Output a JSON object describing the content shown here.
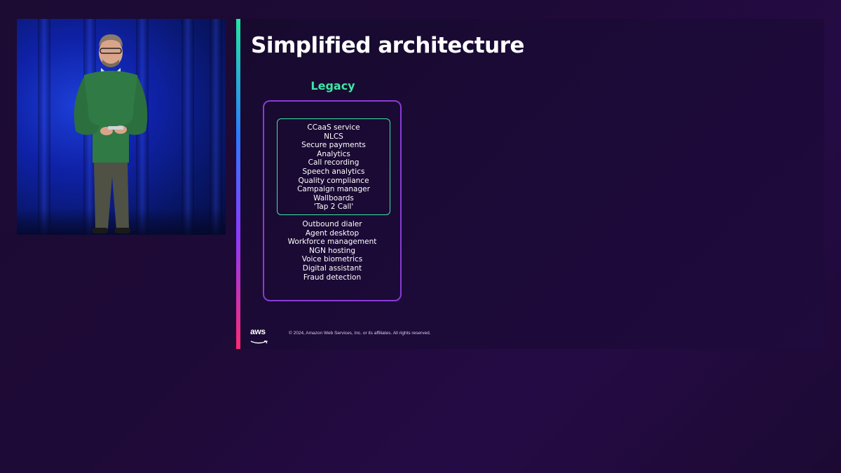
{
  "slide": {
    "title": "Simplified architecture",
    "legacy": {
      "heading": "Legacy",
      "inner_items": [
        "CCaaS service",
        "NLCS",
        "Secure payments",
        "Analytics",
        "Call recording",
        "Speech analytics",
        "Quality compliance",
        "Campaign manager",
        "Wallboards",
        "'Tap 2 Call'"
      ],
      "outer_items": [
        "Outbound dialer",
        "Agent desktop",
        "Workforce management",
        "NGN hosting",
        "Voice biometrics",
        "Digital assistant",
        "Fraud detection"
      ]
    },
    "footer": {
      "logo_text": "aws",
      "copyright": "© 2024, Amazon Web Services, Inc. or its affiliates. All rights reserved."
    }
  },
  "colors": {
    "accent_green": "#3de6a4",
    "accent_purple": "#8a3bd6",
    "background": "#1c0b33"
  }
}
